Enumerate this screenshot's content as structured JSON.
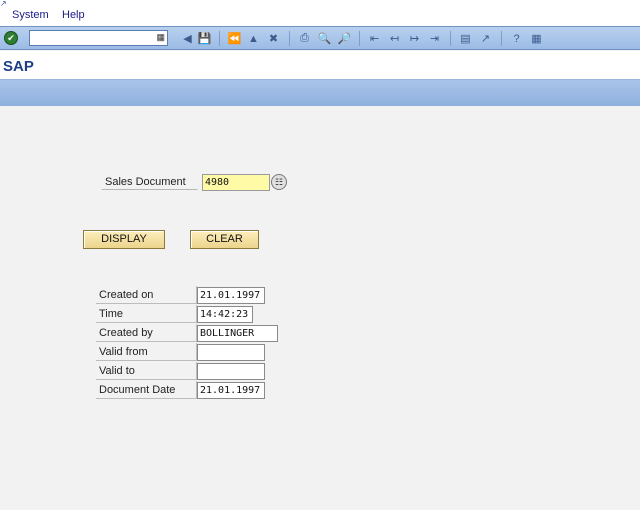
{
  "menubar": {
    "items": [
      {
        "label": "System",
        "mnemonic": "S"
      },
      {
        "label": "Help",
        "mnemonic": "H"
      }
    ]
  },
  "toolbar": {
    "command_field": "",
    "icons": [
      "enter-icon",
      "save-icon",
      "back-icon",
      "exit-icon",
      "cancel-icon",
      "print-icon",
      "find-icon",
      "find-next-icon",
      "first-page-icon",
      "previous-page-icon",
      "next-page-icon",
      "last-page-icon",
      "create-session-icon",
      "shortcut-icon",
      "help-icon",
      "layout-menu-icon"
    ]
  },
  "title": "SAP",
  "sales_document": {
    "label": "Sales Document",
    "value": "4980"
  },
  "buttons": {
    "display": "DISPLAY",
    "clear": "CLEAR"
  },
  "details": [
    {
      "label": "Created on",
      "value": "21.01.1997"
    },
    {
      "label": "Time",
      "value": "14:42:23"
    },
    {
      "label": "Created by",
      "value": "BOLLINGER"
    },
    {
      "label": "Valid from",
      "value": ""
    },
    {
      "label": "Valid to",
      "value": ""
    },
    {
      "label": "Document Date",
      "value": "21.01.1997"
    }
  ],
  "colors": {
    "title_blue": "#1e3f86",
    "toolbar_blue": "#9cbce6",
    "input_yellow": "#fffaa6",
    "button_gold": "#ecd48c"
  }
}
